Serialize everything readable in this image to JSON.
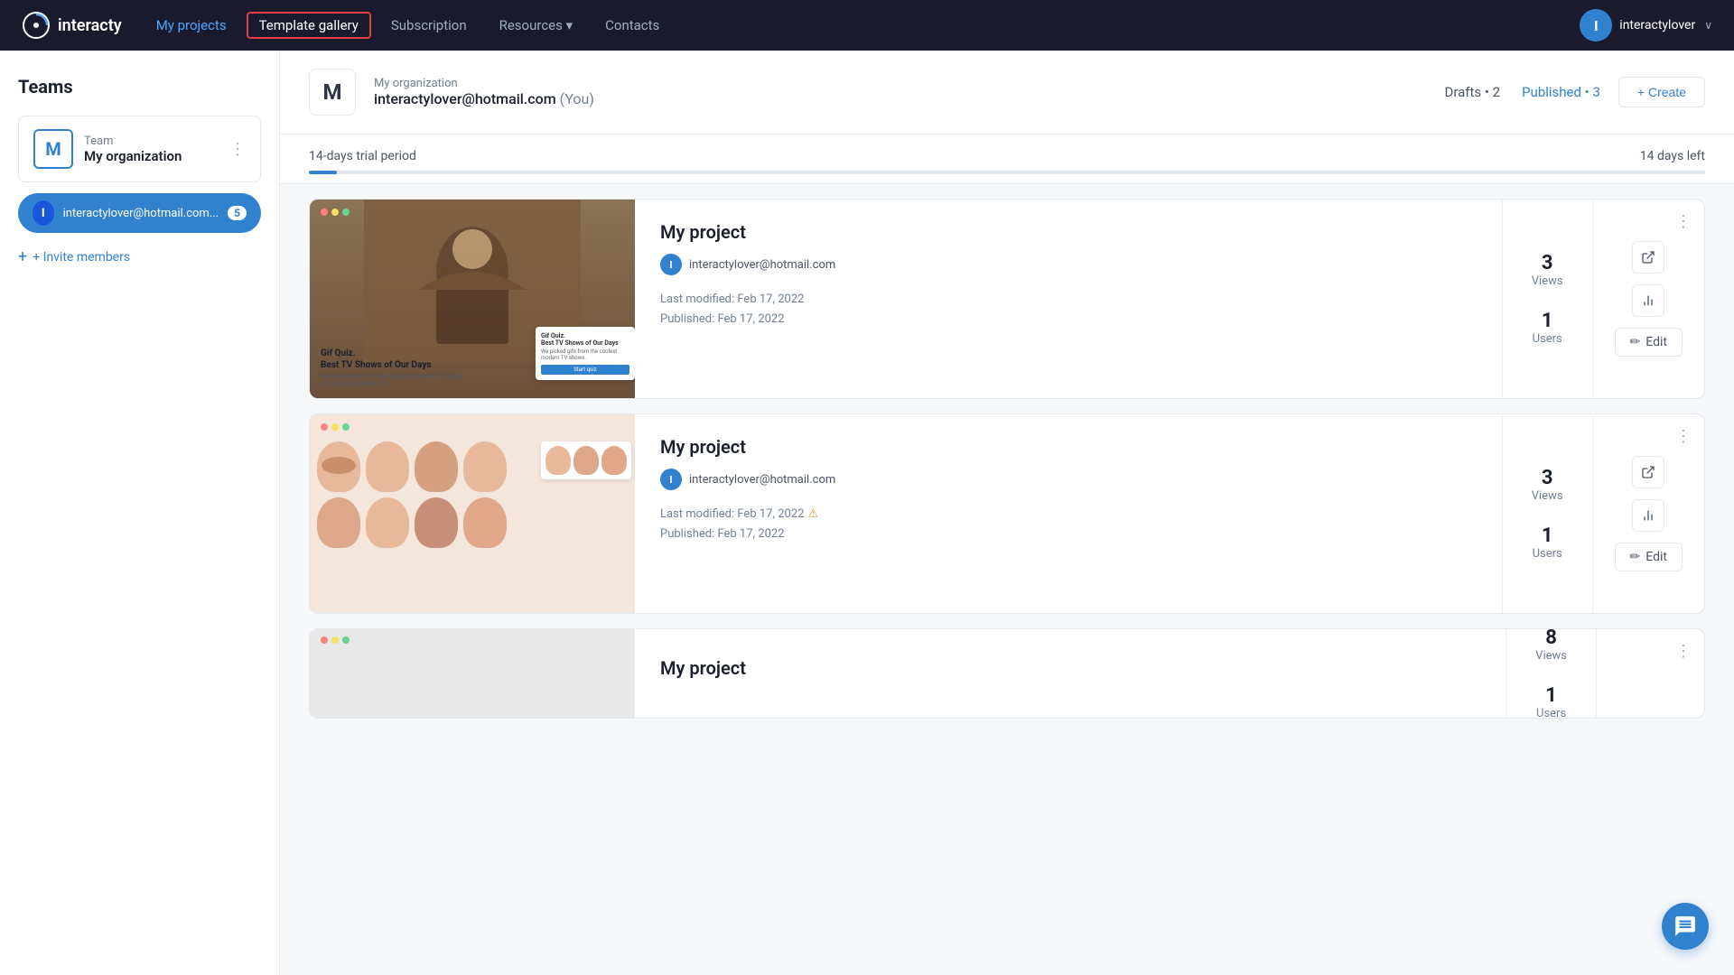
{
  "navbar": {
    "logo_text": "interacty",
    "nav_items": [
      {
        "id": "my-projects",
        "label": "My projects",
        "active": true,
        "highlighted": false
      },
      {
        "id": "template-gallery",
        "label": "Template gallery",
        "active": false,
        "highlighted": true
      },
      {
        "id": "subscription",
        "label": "Subscription",
        "active": false,
        "highlighted": false
      },
      {
        "id": "resources",
        "label": "Resources ▾",
        "active": false,
        "highlighted": false
      },
      {
        "id": "contacts",
        "label": "Contacts",
        "active": false,
        "highlighted": false
      }
    ],
    "user": {
      "avatar_letter": "I",
      "username": "interactylover",
      "chevron": "∨"
    }
  },
  "sidebar": {
    "title": "Teams",
    "team": {
      "avatar_letter": "M",
      "label": "Team",
      "name": "My organization"
    },
    "user": {
      "avatar_letter": "I",
      "email": "interactylover@hotmail.com...",
      "badge": "5"
    },
    "invite_label": "+ Invite members"
  },
  "org_header": {
    "avatar_letter": "M",
    "org_name": "My organization",
    "email": "interactylover@hotmail.com",
    "you_label": "(You)",
    "drafts_label": "Drafts • 2",
    "published_label": "Published • 3",
    "create_btn": "+ Create"
  },
  "trial": {
    "text": "14-days trial period",
    "days_left": "14 days left",
    "progress_pct": 2
  },
  "projects": [
    {
      "id": "project-1",
      "title": "My project",
      "user_email": "interactylover@hotmail.com",
      "last_modified": "Last modified: Feb 17, 2022",
      "published": "Published: Feb 17, 2022",
      "views": "3",
      "views_label": "Views",
      "users": "1",
      "users_label": "Users",
      "thumb_type": "game",
      "thumb_title": "Gif Quiz.\nBest TV Shows of Our Days",
      "thumb_subtitle": "We picked gifs from the coolest modern TV shows.\nCan you show them all?",
      "has_warning": false
    },
    {
      "id": "project-2",
      "title": "My project",
      "user_email": "interactylover@hotmail.com",
      "last_modified": "Last modified: Feb 17, 2022",
      "published": "Published: Feb 17, 2022",
      "views": "3",
      "views_label": "Views",
      "users": "1",
      "users_label": "Users",
      "thumb_type": "faces",
      "has_warning": true
    },
    {
      "id": "project-3",
      "title": "My project",
      "user_email": "",
      "views": "8",
      "views_label": "Views",
      "users": "1",
      "users_label": "Users",
      "thumb_type": "partial"
    }
  ],
  "actions": {
    "external_icon": "⬡",
    "stats_icon": "⌇",
    "edit_label": "Edit",
    "edit_icon": "✏"
  }
}
